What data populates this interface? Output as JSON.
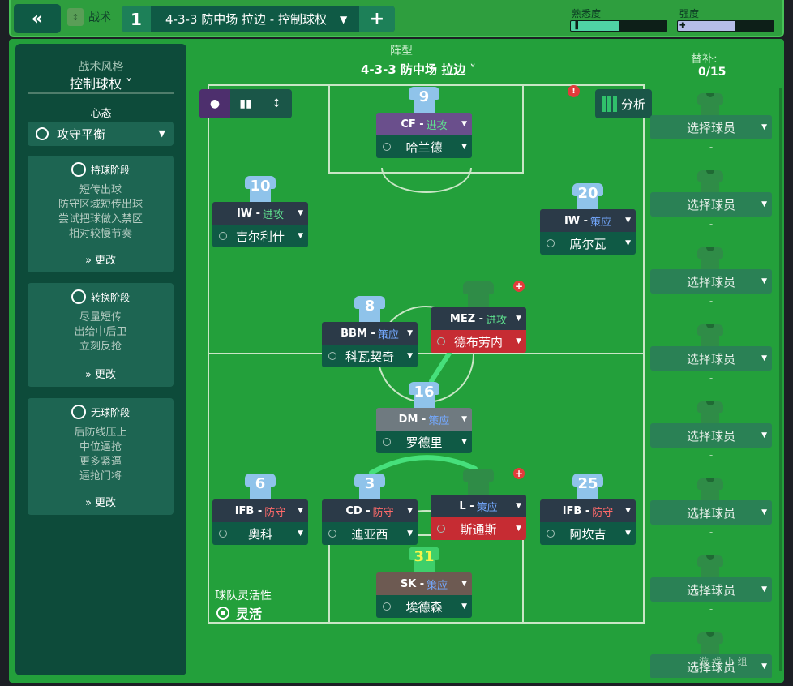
{
  "topbar": {
    "back_icon": "«",
    "tactics_tab_label": "战术",
    "tactic_slot": "1",
    "tactic_name": "4-3-3 防中场 拉边 - 控制球权",
    "add_icon": "+",
    "familiarity_label": "熟悉度",
    "familiarity_level": 0.5,
    "intensity_label": "强度",
    "intensity_level": 0.6
  },
  "sidebar": {
    "style_label": "战术风格",
    "style_value": "控制球权 ˅",
    "mentality_label": "心态",
    "mentality_value": "攻守平衡",
    "in_possession": {
      "title": "持球阶段",
      "lines": [
        "短传出球",
        "防守区域短传出球",
        "尝试把球做入禁区",
        "相对较慢节奏"
      ],
      "change": "» 更改"
    },
    "in_transition": {
      "title": "转换阶段",
      "lines": [
        "尽量短传",
        "出给中后卫",
        "立刻反抢"
      ],
      "change": "» 更改"
    },
    "out_of_possession": {
      "title": "无球阶段",
      "lines": [
        "后防线压上",
        "中位逼抢",
        "更多紧逼",
        "逼抢门将"
      ],
      "change": "» 更改"
    }
  },
  "formation": {
    "label": "阵型",
    "value": "4-3-3 防中场 拉边 ˅"
  },
  "analysis_label": "分析",
  "fluidity": {
    "label": "球队灵活性",
    "value": "灵活"
  },
  "colors": {
    "pitch": "#23a03b",
    "role_bar": "#2b3a48",
    "name_bar": "#0f5a45",
    "warn_red": "#c62c33",
    "attack": "#5fe38f",
    "support": "#74a9ff",
    "defend": "#ff6a6a"
  },
  "players": [
    {
      "num": "9",
      "role": "CF",
      "duty": "进攻",
      "duty_type": "attack",
      "name": "哈兰德",
      "role_bg": "purple"
    },
    {
      "num": "10",
      "role": "IW",
      "duty": "进攻",
      "duty_type": "attack",
      "name": "吉尔利什"
    },
    {
      "num": "20",
      "role": "IW",
      "duty": "策应",
      "duty_type": "support",
      "name": "席尔瓦"
    },
    {
      "num": "8",
      "role": "BBM",
      "duty": "策应",
      "duty_type": "support",
      "name": "科瓦契奇"
    },
    {
      "num": "",
      "role": "MEZ",
      "duty": "进攻",
      "duty_type": "attack",
      "name": "德布劳内",
      "empty": true
    },
    {
      "num": "16",
      "role": "DM",
      "duty": "策应",
      "duty_type": "support",
      "name": "罗德里",
      "role_bg": "grey"
    },
    {
      "num": "6",
      "role": "IFB",
      "duty": "防守",
      "duty_type": "defend",
      "name": "奥科"
    },
    {
      "num": "3",
      "role": "CD",
      "duty": "防守",
      "duty_type": "defend",
      "name": "迪亚西"
    },
    {
      "num": "",
      "role": "L",
      "duty": "策应",
      "duty_type": "support",
      "name": "斯通斯",
      "empty": true
    },
    {
      "num": "25",
      "role": "IFB",
      "duty": "防守",
      "duty_type": "defend",
      "name": "阿坎吉"
    },
    {
      "num": "31",
      "role": "SK",
      "duty": "策应",
      "duty_type": "support",
      "name": "埃德森",
      "gk": true,
      "role_bg": "brown"
    }
  ],
  "subs": {
    "title": "替补:",
    "count": "0/15",
    "slots": [
      {
        "label": "选择球员",
        "dash": "-"
      },
      {
        "label": "选择球员",
        "dash": "-"
      },
      {
        "label": "选择球员",
        "dash": "-"
      },
      {
        "label": "选择球员",
        "dash": "-"
      },
      {
        "label": "选择球员",
        "dash": "-"
      },
      {
        "label": "选择球员",
        "dash": "-"
      },
      {
        "label": "选择球员",
        "dash": "-"
      },
      {
        "label": "选择球员",
        "dash": "-"
      }
    ]
  },
  "watermark": "游 戏 小 组"
}
